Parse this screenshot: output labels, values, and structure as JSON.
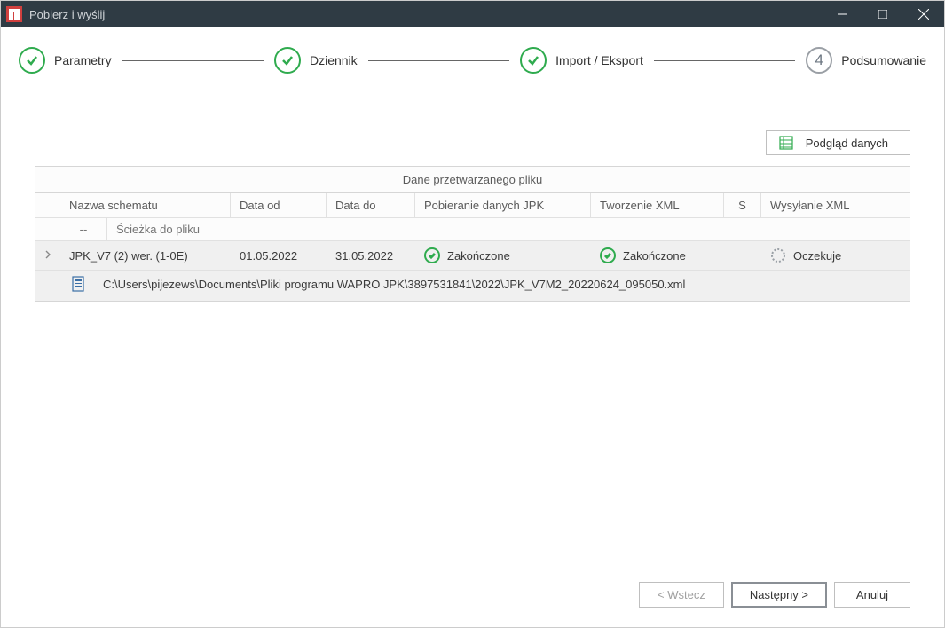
{
  "window": {
    "title": "Pobierz i wyślij"
  },
  "stepper": {
    "steps": [
      {
        "label": "Parametry",
        "state": "done"
      },
      {
        "label": "Dziennik",
        "state": "done"
      },
      {
        "label": "Import / Eksport",
        "state": "done"
      },
      {
        "label": "Podsumowanie",
        "state": "current",
        "number": "4"
      }
    ]
  },
  "toolbar": {
    "preview_label": "Podgląd danych"
  },
  "grid": {
    "title": "Dane przetwarzanego pliku",
    "headers": {
      "schema": "Nazwa schematu",
      "od": "Data od",
      "do": "Data do",
      "pobieranie": "Pobieranie danych JPK",
      "tworzenie": "Tworzenie XML",
      "s": "S",
      "wysylanie": "Wysyłanie XML"
    },
    "subheader": {
      "dash": "--",
      "path": "Ścieżka do pliku"
    },
    "rows": [
      {
        "schema": "JPK_V7 (2) wer. (1-0E)",
        "od": "01.05.2022",
        "do": "31.05.2022",
        "pobieranie": "Zakończone",
        "tworzenie": "Zakończone",
        "wysylanie": "Oczekuje",
        "expand": "›",
        "path": "C:\\Users\\pijezews\\Documents\\Pliki programu WAPRO JPK\\3897531841\\2022\\JPK_V7M2_20220624_095050.xml"
      }
    ]
  },
  "footer": {
    "back": "< Wstecz",
    "next": "Następny >",
    "cancel": "Anuluj"
  }
}
